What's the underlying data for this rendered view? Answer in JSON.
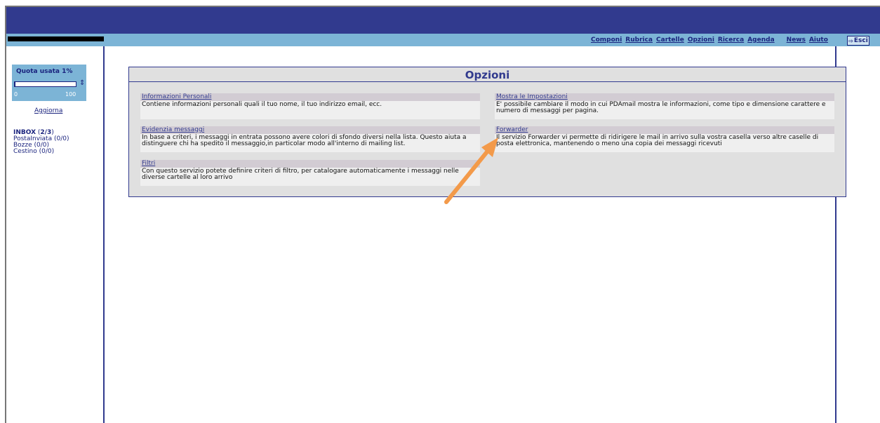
{
  "nav": {
    "items": [
      "Componi",
      "Rubrica",
      "Cartelle",
      "Opzioni",
      "Ricerca",
      "Agenda",
      "News",
      "Aiuto"
    ],
    "exit_label": "Esci"
  },
  "quota": {
    "title": "Quota usata 1%",
    "min": "0",
    "max": "100",
    "percent": 1,
    "refresh_label": "Aggiorna"
  },
  "folders": [
    {
      "name": "INBOX",
      "count_open": " (",
      "count": "2/3",
      "count_close": ")"
    },
    {
      "name": "PostaInviata",
      "label": "PostaInviata (0/0)"
    },
    {
      "name": "Bozze",
      "label": "Bozze (0/0)"
    },
    {
      "name": "Cestino",
      "label": "Cestino (0/0)"
    }
  ],
  "options": {
    "title": "Opzioni",
    "items": [
      {
        "title": "Informazioni Personali",
        "description": "Contiene informazioni personali quali il tuo nome, il tuo indirizzo email, ecc."
      },
      {
        "title": "Mostra le Impostazioni",
        "description": "E' possibile cambiare il modo in cui PDAmail mostra le informazioni, come tipo e dimensione carattere e numero di messaggi per pagina."
      },
      {
        "title": "Evidenzia messaggi",
        "description": "In base a criteri, i messaggi in entrata possono avere colori di sfondo diversi nella lista. Questo aiuta a distinguere chi ha spedito il messaggio,in particolar modo all'interno di mailing list."
      },
      {
        "title": "Forwarder",
        "description": "Il servizio Forwarder vi permette di ridirigere le mail in arrivo sulla vostra casella verso altre caselle di posta elettronica, mantenendo o meno una copia dei messaggi ricevuti"
      },
      {
        "title": "Filtri",
        "description": "Con questo servizio potete definire criteri di filtro, per catalogare automaticamente i messaggi nelle diverse cartelle al loro arrivo"
      }
    ]
  },
  "colors": {
    "header": "#313a8e",
    "menu_bar": "#7cb4d6",
    "annotation_arrow": "#f39a4a"
  }
}
